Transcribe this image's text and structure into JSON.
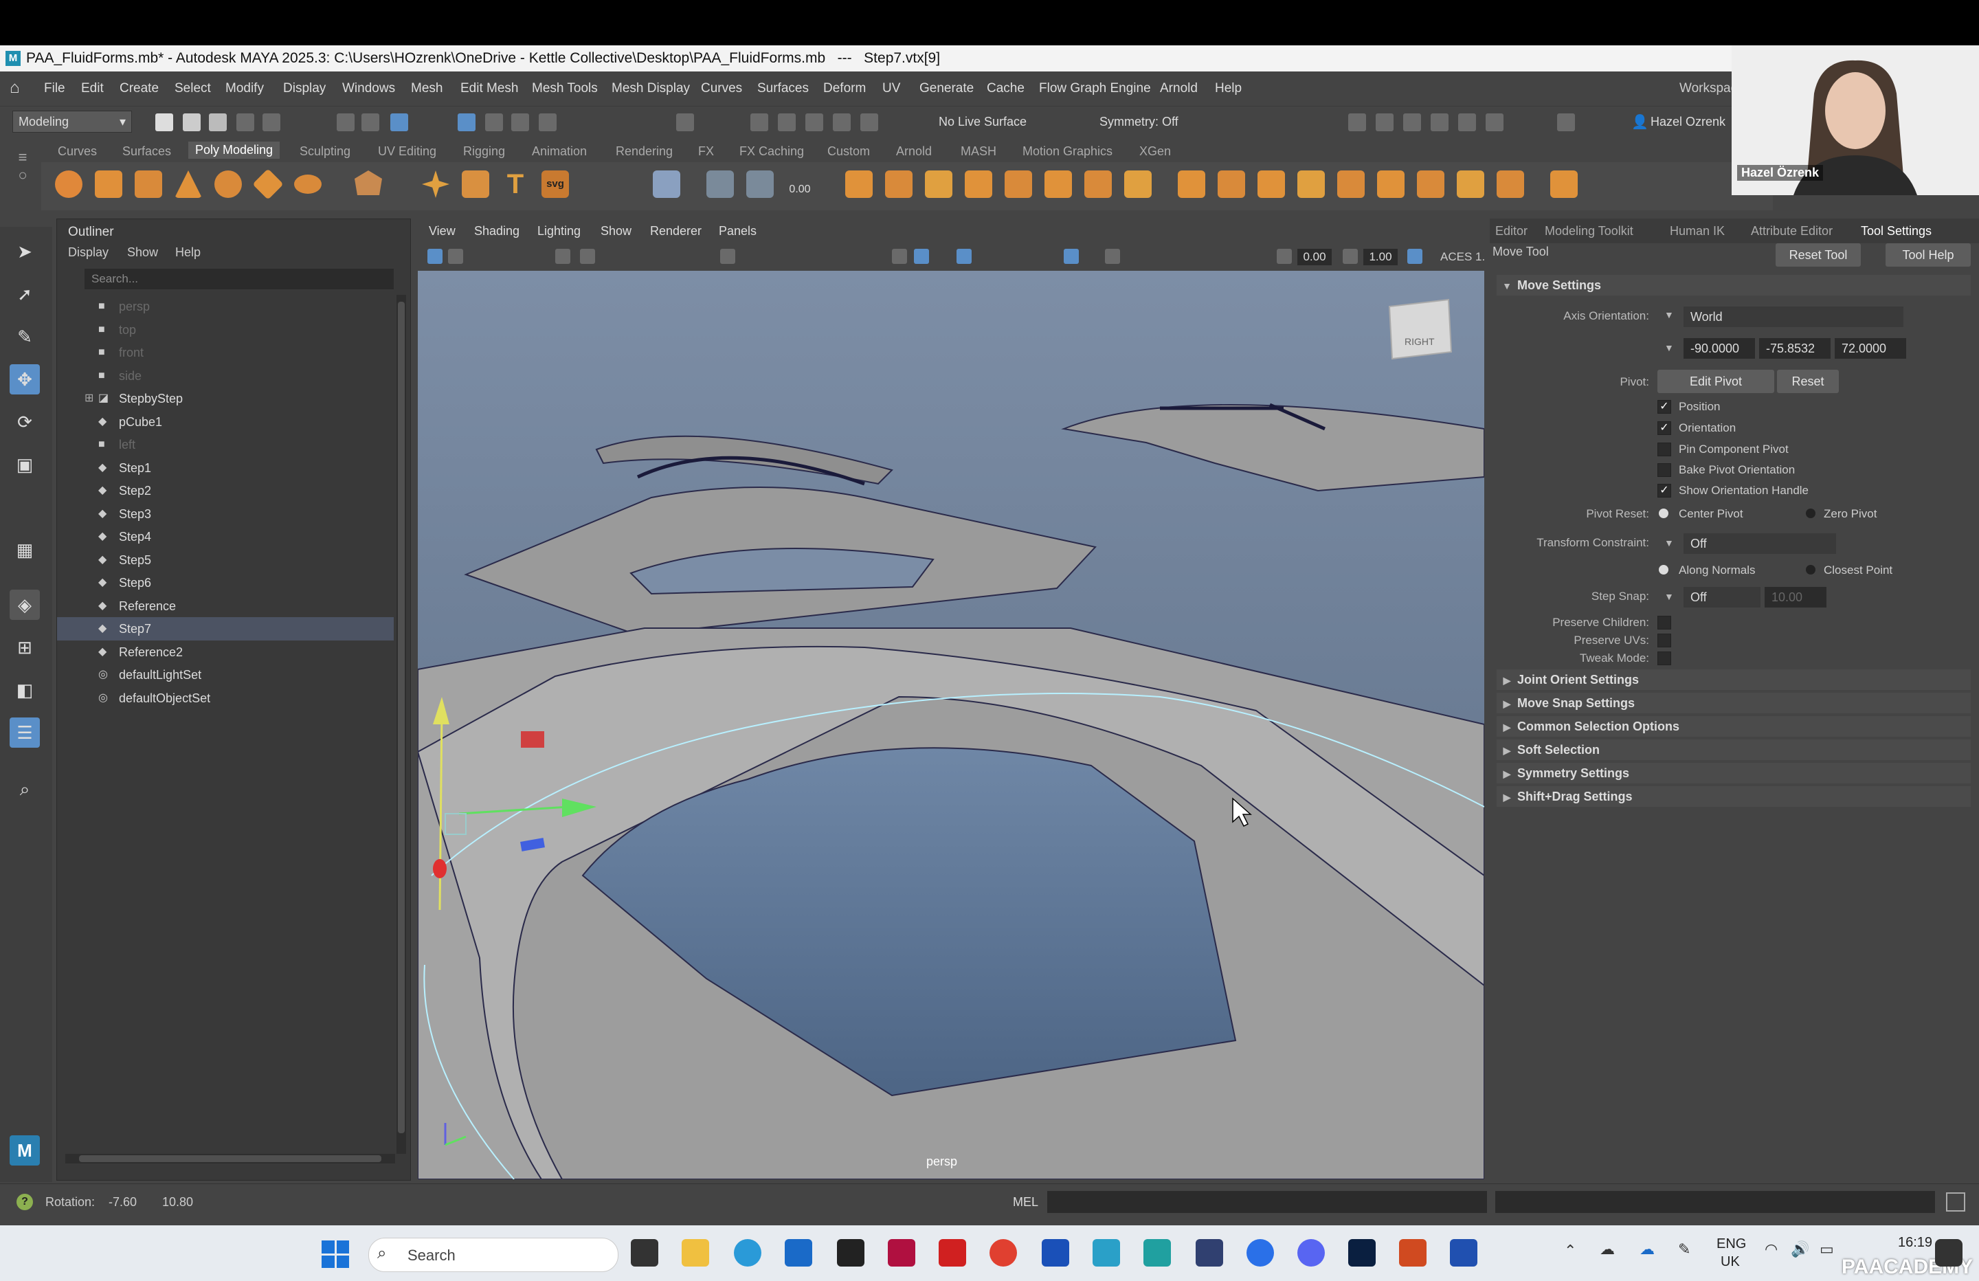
{
  "window": {
    "title": "PAA_FluidForms.mb* - Autodesk MAYA 2025.3: C:\\Users\\HOzrenk\\OneDrive - Kettle Collective\\Desktop\\PAA_FluidForms.mb   ---   Step7.vtx[9]"
  },
  "menubar": {
    "items": [
      "File",
      "Edit",
      "Create",
      "Select",
      "Modify",
      "Display",
      "Windows",
      "Mesh",
      "Edit Mesh",
      "Mesh Tools",
      "Mesh Display",
      "Curves",
      "Surfaces",
      "Deform",
      "UV",
      "Generate",
      "Cache",
      "Flow Graph Engine",
      "Arnold",
      "Help"
    ],
    "workspace": "Workspac"
  },
  "statusline": {
    "mode": "Modeling",
    "live_surface": "No Live Surface",
    "symmetry": "Symmetry: Off",
    "user": "Hazel Ozrenk"
  },
  "shelf": {
    "tabs": [
      "Curves",
      "Surfaces",
      "Poly Modeling",
      "Sculpting",
      "UV Editing",
      "Rigging",
      "Animation",
      "Rendering",
      "FX",
      "FX Caching",
      "Custom",
      "Arnold",
      "MASH",
      "Motion Graphics",
      "XGen"
    ],
    "active_tab": "Poly Modeling",
    "svg_label": "svg",
    "value_label": "0.00"
  },
  "outliner": {
    "title": "Outliner",
    "menu": [
      "Display",
      "Show",
      "Help"
    ],
    "search_placeholder": "Search...",
    "rows": [
      {
        "label": "persp",
        "icon": "camera-icon",
        "dim": true
      },
      {
        "label": "top",
        "icon": "camera-icon",
        "dim": true
      },
      {
        "label": "front",
        "icon": "camera-icon",
        "dim": true
      },
      {
        "label": "side",
        "icon": "camera-icon",
        "dim": true
      },
      {
        "label": "StepbyStep",
        "icon": "group-icon",
        "dim": false
      },
      {
        "label": "pCube1",
        "icon": "mesh-icon",
        "dim": false
      },
      {
        "label": "left",
        "icon": "camera-icon",
        "dim": true
      },
      {
        "label": "Step1",
        "icon": "mesh-icon",
        "dim": false
      },
      {
        "label": "Step2",
        "icon": "mesh-icon",
        "dim": false
      },
      {
        "label": "Step3",
        "icon": "mesh-icon",
        "dim": false
      },
      {
        "label": "Step4",
        "icon": "mesh-icon",
        "dim": false
      },
      {
        "label": "Step5",
        "icon": "mesh-icon",
        "dim": false
      },
      {
        "label": "Step6",
        "icon": "mesh-icon",
        "dim": false
      },
      {
        "label": "Reference",
        "icon": "mesh-icon",
        "dim": false
      },
      {
        "label": "Step7",
        "icon": "mesh-icon",
        "dim": false,
        "selected": true
      },
      {
        "label": "Reference2",
        "icon": "mesh-icon",
        "dim": false
      },
      {
        "label": "defaultLightSet",
        "icon": "set-icon",
        "dim": false
      },
      {
        "label": "defaultObjectSet",
        "icon": "set-icon",
        "dim": false
      }
    ]
  },
  "viewport": {
    "menu": [
      "View",
      "Shading",
      "Lighting",
      "Show",
      "Renderer",
      "Panels"
    ],
    "field1": "0.00",
    "field2": "1.00",
    "colorspace": "ACES 1.",
    "camera_label": "persp",
    "viewcube_label": "RIGHT"
  },
  "right_panel": {
    "tabs": [
      "Editor",
      "Modeling Toolkit",
      "Human IK",
      "Attribute Editor",
      "Tool Settings"
    ],
    "active_tab": "Tool Settings",
    "tool_name": "Move Tool",
    "reset_tool": "Reset Tool",
    "tool_help": "Tool Help",
    "move_settings": {
      "header": "Move Settings",
      "axis_orientation_label": "Axis Orientation:",
      "axis_orientation": "World",
      "rot_x": "-90.0000",
      "rot_y": "-75.8532",
      "rot_z": "72.0000",
      "pivot_label": "Pivot:",
      "edit_pivot": "Edit Pivot",
      "reset": "Reset",
      "position": "Position",
      "orientation": "Orientation",
      "pin_component_pivot": "Pin Component Pivot",
      "bake_pivot_orientation": "Bake Pivot Orientation",
      "show_orientation_handle": "Show Orientation Handle",
      "pivot_reset_label": "Pivot Reset:",
      "center_pivot": "Center Pivot",
      "zero_pivot": "Zero Pivot",
      "transform_constraint_label": "Transform Constraint:",
      "transform_constraint": "Off",
      "along_normals": "Along Normals",
      "closest_point": "Closest Point",
      "step_snap_label": "Step Snap:",
      "step_snap": "Off",
      "step_snap_value": "10.00",
      "preserve_children": "Preserve Children:",
      "preserve_uvs": "Preserve UVs:",
      "tweak_mode": "Tweak Mode:"
    },
    "sections": [
      "Joint Orient Settings",
      "Move Snap Settings",
      "Common Selection Options",
      "Soft Selection",
      "Symmetry Settings",
      "Shift+Drag Settings"
    ]
  },
  "helpline": {
    "rotation_label": "Rotation:",
    "rotation_x": "-7.60",
    "rotation_y": "10.80",
    "mel": "MEL"
  },
  "taskbar": {
    "search": "Search",
    "lang1": "ENG",
    "lang2": "UK",
    "time": "16:19"
  },
  "webcam": {
    "name": "Hazel Özrenk"
  },
  "watermark": "PAACADEMY"
}
